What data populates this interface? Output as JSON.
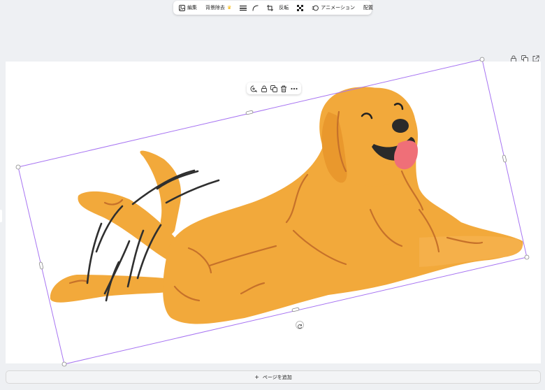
{
  "toolbar": {
    "edit_label": "編集",
    "remove_bg_label": "背景除去",
    "flip_label": "反転",
    "animation_label": "アニメーション",
    "arrange_label": "配置"
  },
  "page": {
    "add_page_label": "ページを追加",
    "add_icon": "+"
  },
  "colors": {
    "selection": "#a774f2",
    "dog": "#f2a93b",
    "dog_line": "#c6712a",
    "tongue": "#ef6f78"
  },
  "icons": {
    "edit": "image-edit-icon",
    "crown": "crown-icon",
    "border": "border-style-icon",
    "corner": "corner-rounding-icon",
    "crop": "crop-icon",
    "transparency": "transparency-icon",
    "animate": "animation-icon",
    "lock": "lock-icon",
    "duplicate": "duplicate-icon",
    "trash": "trash-icon",
    "more": "more-icon",
    "rotate": "rotate-icon",
    "export": "export-icon",
    "comment": "comment-add-icon"
  }
}
